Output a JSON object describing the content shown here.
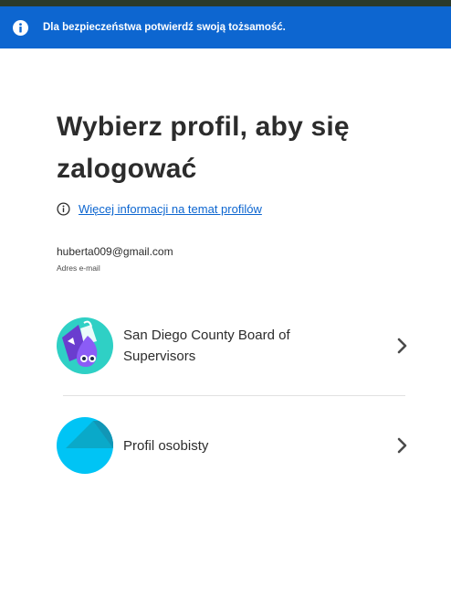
{
  "banner": {
    "text": "Dla bezpieczeństwa potwierdź swoją tożsamość.",
    "icon": "info-icon",
    "color": "#0d66d0"
  },
  "heading": "Wybierz profil, aby się zalogować",
  "info_link": {
    "label": "Więcej informacji na temat profilów",
    "icon": "info-circle-icon"
  },
  "account": {
    "email": "huberta009@gmail.com",
    "email_label": "Adres e-mail"
  },
  "profiles": [
    {
      "name": "San Diego County Board of Supervisors",
      "avatar_icon": "creative-character-avatar",
      "action_icon": "chevron-right-icon"
    },
    {
      "name": "Profil osobisty",
      "avatar_icon": "personal-profile-avatar",
      "action_icon": "chevron-right-icon"
    }
  ],
  "colors": {
    "accent": "#0d66d0",
    "text": "#2c2c2c",
    "avatar_teal": "#2fd0c5",
    "avatar_blue": "#00c4f5"
  }
}
